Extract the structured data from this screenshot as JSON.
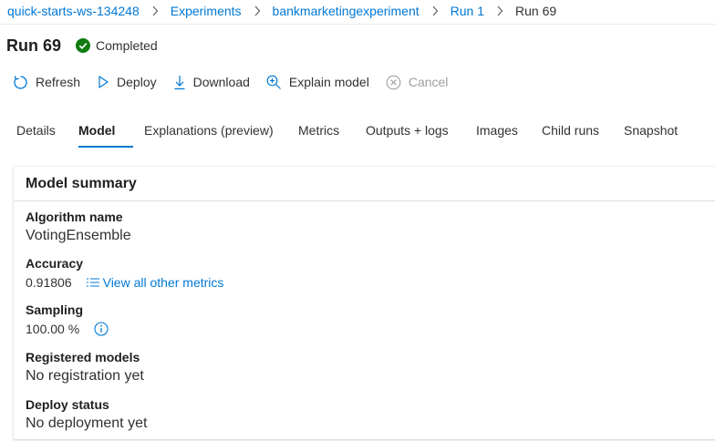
{
  "breadcrumb": [
    "quick-starts-ws-134248",
    "Experiments",
    "bankmarketingexperiment",
    "Run 1",
    "Run 69"
  ],
  "header": {
    "title": "Run 69",
    "status": "Completed",
    "status_color": "#107c10"
  },
  "toolbar": {
    "refresh": "Refresh",
    "deploy": "Deploy",
    "download": "Download",
    "explain": "Explain model",
    "cancel": "Cancel"
  },
  "tabs": [
    "Details",
    "Model",
    "Explanations (preview)",
    "Metrics",
    "Outputs + logs",
    "Images",
    "Child runs",
    "Snapshot"
  ],
  "active_tab": "Model",
  "model_summary": {
    "title": "Model summary",
    "algorithm_label": "Algorithm name",
    "algorithm_value": "VotingEnsemble",
    "accuracy_label": "Accuracy",
    "accuracy_value": "0.91806",
    "metrics_link": "View all other metrics",
    "sampling_label": "Sampling",
    "sampling_value": "100.00 %",
    "registered_label": "Registered models",
    "registered_value": "No registration yet",
    "deploy_label": "Deploy status",
    "deploy_value": "No deployment yet"
  },
  "colors": {
    "accent": "#0078d4",
    "text": "#323130",
    "disabled": "#a19f9d"
  }
}
